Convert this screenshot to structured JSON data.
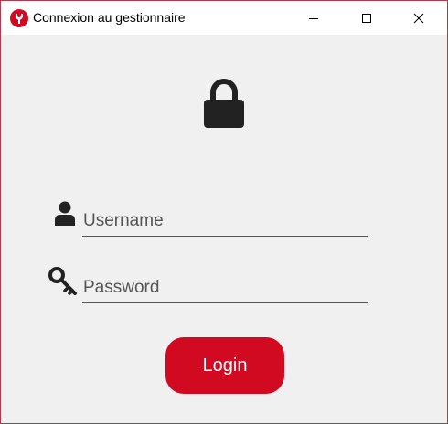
{
  "window": {
    "title": "Connexion au gestionnaire",
    "icons": {
      "app": "app-logo-icon",
      "minimize": "minimize-icon",
      "maximize": "maximize-icon",
      "close": "close-icon"
    },
    "border_color": "#b4364a"
  },
  "form": {
    "lock_icon": "lock-icon",
    "username": {
      "icon": "user-icon",
      "placeholder": "Username",
      "value": ""
    },
    "password": {
      "icon": "key-icon",
      "placeholder": "Password",
      "value": ""
    },
    "login_label": "Login",
    "accent_color": "#d10a21"
  }
}
